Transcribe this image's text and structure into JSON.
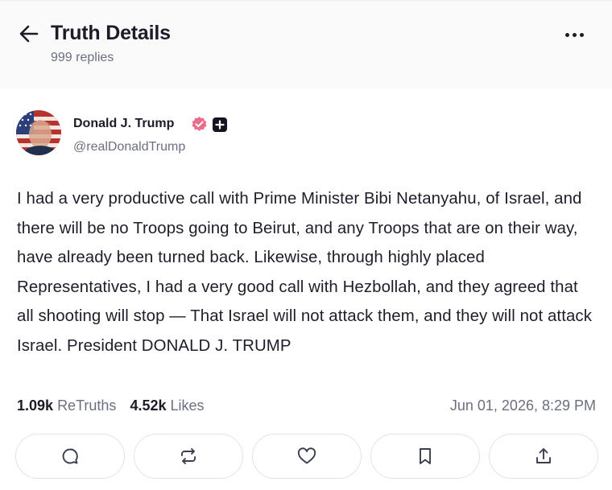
{
  "header": {
    "title": "Truth Details",
    "subtitle": "999 replies",
    "back_icon": "arrow-left-icon",
    "more_icon": "more-horizontal-icon"
  },
  "post": {
    "author_name": "Donald J. Trump",
    "author_handle": "@realDonaldTrump",
    "text": "I had a very productive call with Prime Minister Bibi Netanyahu, of Israel, and there will be no Troops going to Beirut, and any Troops that are on their way, have already been turned back. Likewise, through highly placed Representatives, I had a very good call with Hezbollah, and they agreed that all shooting will stop — That Israel will not attack them, and they will not attack Israel. President DONALD J. TRUMP",
    "retruths_count": "1.09k",
    "retruths_label": "ReTruths",
    "likes_count": "4.52k",
    "likes_label": "Likes",
    "timestamp": "Jun 01, 2026, 8:29 PM"
  },
  "actions": [
    {
      "name": "reply",
      "icon": "comment-icon"
    },
    {
      "name": "retruth",
      "icon": "repost-icon"
    },
    {
      "name": "like",
      "icon": "heart-icon"
    },
    {
      "name": "bookmark",
      "icon": "bookmark-icon"
    },
    {
      "name": "share",
      "icon": "share-icon"
    }
  ],
  "colors": {
    "verified_badge": "#e96c8a",
    "text_primary": "#1c1c28",
    "text_secondary": "#6b6f80",
    "border": "#e2e3ea"
  }
}
